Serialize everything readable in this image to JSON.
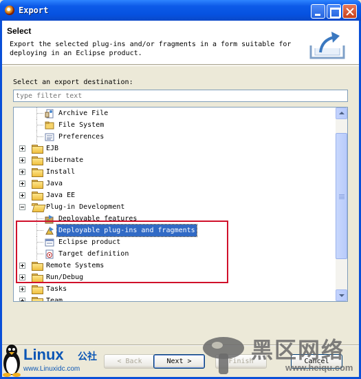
{
  "window": {
    "title": "Export"
  },
  "banner": {
    "title": "Select",
    "description_line1": "Export the selected plug-ins and/or fragments in a form suitable for",
    "description_line2": "deploying in an Eclipse product."
  },
  "destination": {
    "label": "Select an export destination:",
    "filter_placeholder": "type filter text",
    "filter_value": ""
  },
  "tree": {
    "items": [
      {
        "label": "Archive File",
        "level": 1,
        "type": "leaf",
        "icon": "archive-file-icon"
      },
      {
        "label": "File System",
        "level": 1,
        "type": "leaf",
        "icon": "file-system-icon"
      },
      {
        "label": "Preferences",
        "level": 1,
        "type": "leaf",
        "icon": "preferences-icon"
      },
      {
        "label": "EJB",
        "level": 0,
        "type": "folder",
        "expanded": false
      },
      {
        "label": "Hibernate",
        "level": 0,
        "type": "folder",
        "expanded": false
      },
      {
        "label": "Install",
        "level": 0,
        "type": "folder",
        "expanded": false
      },
      {
        "label": "Java",
        "level": 0,
        "type": "folder",
        "expanded": false
      },
      {
        "label": "Java EE",
        "level": 0,
        "type": "folder",
        "expanded": false
      },
      {
        "label": "Plug-in Development",
        "level": 0,
        "type": "folder",
        "expanded": true
      },
      {
        "label": "Deployable features",
        "level": 1,
        "type": "leaf",
        "icon": "deployable-features-icon"
      },
      {
        "label": "Deployable plug-ins and fragments",
        "level": 1,
        "type": "leaf",
        "icon": "deployable-plugins-icon",
        "selected": true
      },
      {
        "label": "Eclipse product",
        "level": 1,
        "type": "leaf",
        "icon": "eclipse-product-icon"
      },
      {
        "label": "Target definition",
        "level": 1,
        "type": "leaf",
        "icon": "target-definition-icon"
      },
      {
        "label": "Remote Systems",
        "level": 0,
        "type": "folder",
        "expanded": false
      },
      {
        "label": "Run/Debug",
        "level": 0,
        "type": "folder",
        "expanded": false
      },
      {
        "label": "Tasks",
        "level": 0,
        "type": "folder",
        "expanded": false
      },
      {
        "label": "Team",
        "level": 0,
        "type": "folder",
        "expanded": false
      }
    ]
  },
  "buttons": {
    "back": "< Back",
    "next": "Next >",
    "finish": "Finish",
    "cancel": "Cancel"
  },
  "watermarks": {
    "linux_brand": "Linux",
    "linux_brand_cn": "公社",
    "linux_url": "www.Linuxidc.com",
    "heiqu_brand_cn": "黑区网络",
    "heiqu_url": "www.heiqu.com"
  },
  "colors": {
    "selection": "#316ac5",
    "highlight_box": "#d0102a",
    "titlebar": "#0652e0"
  }
}
